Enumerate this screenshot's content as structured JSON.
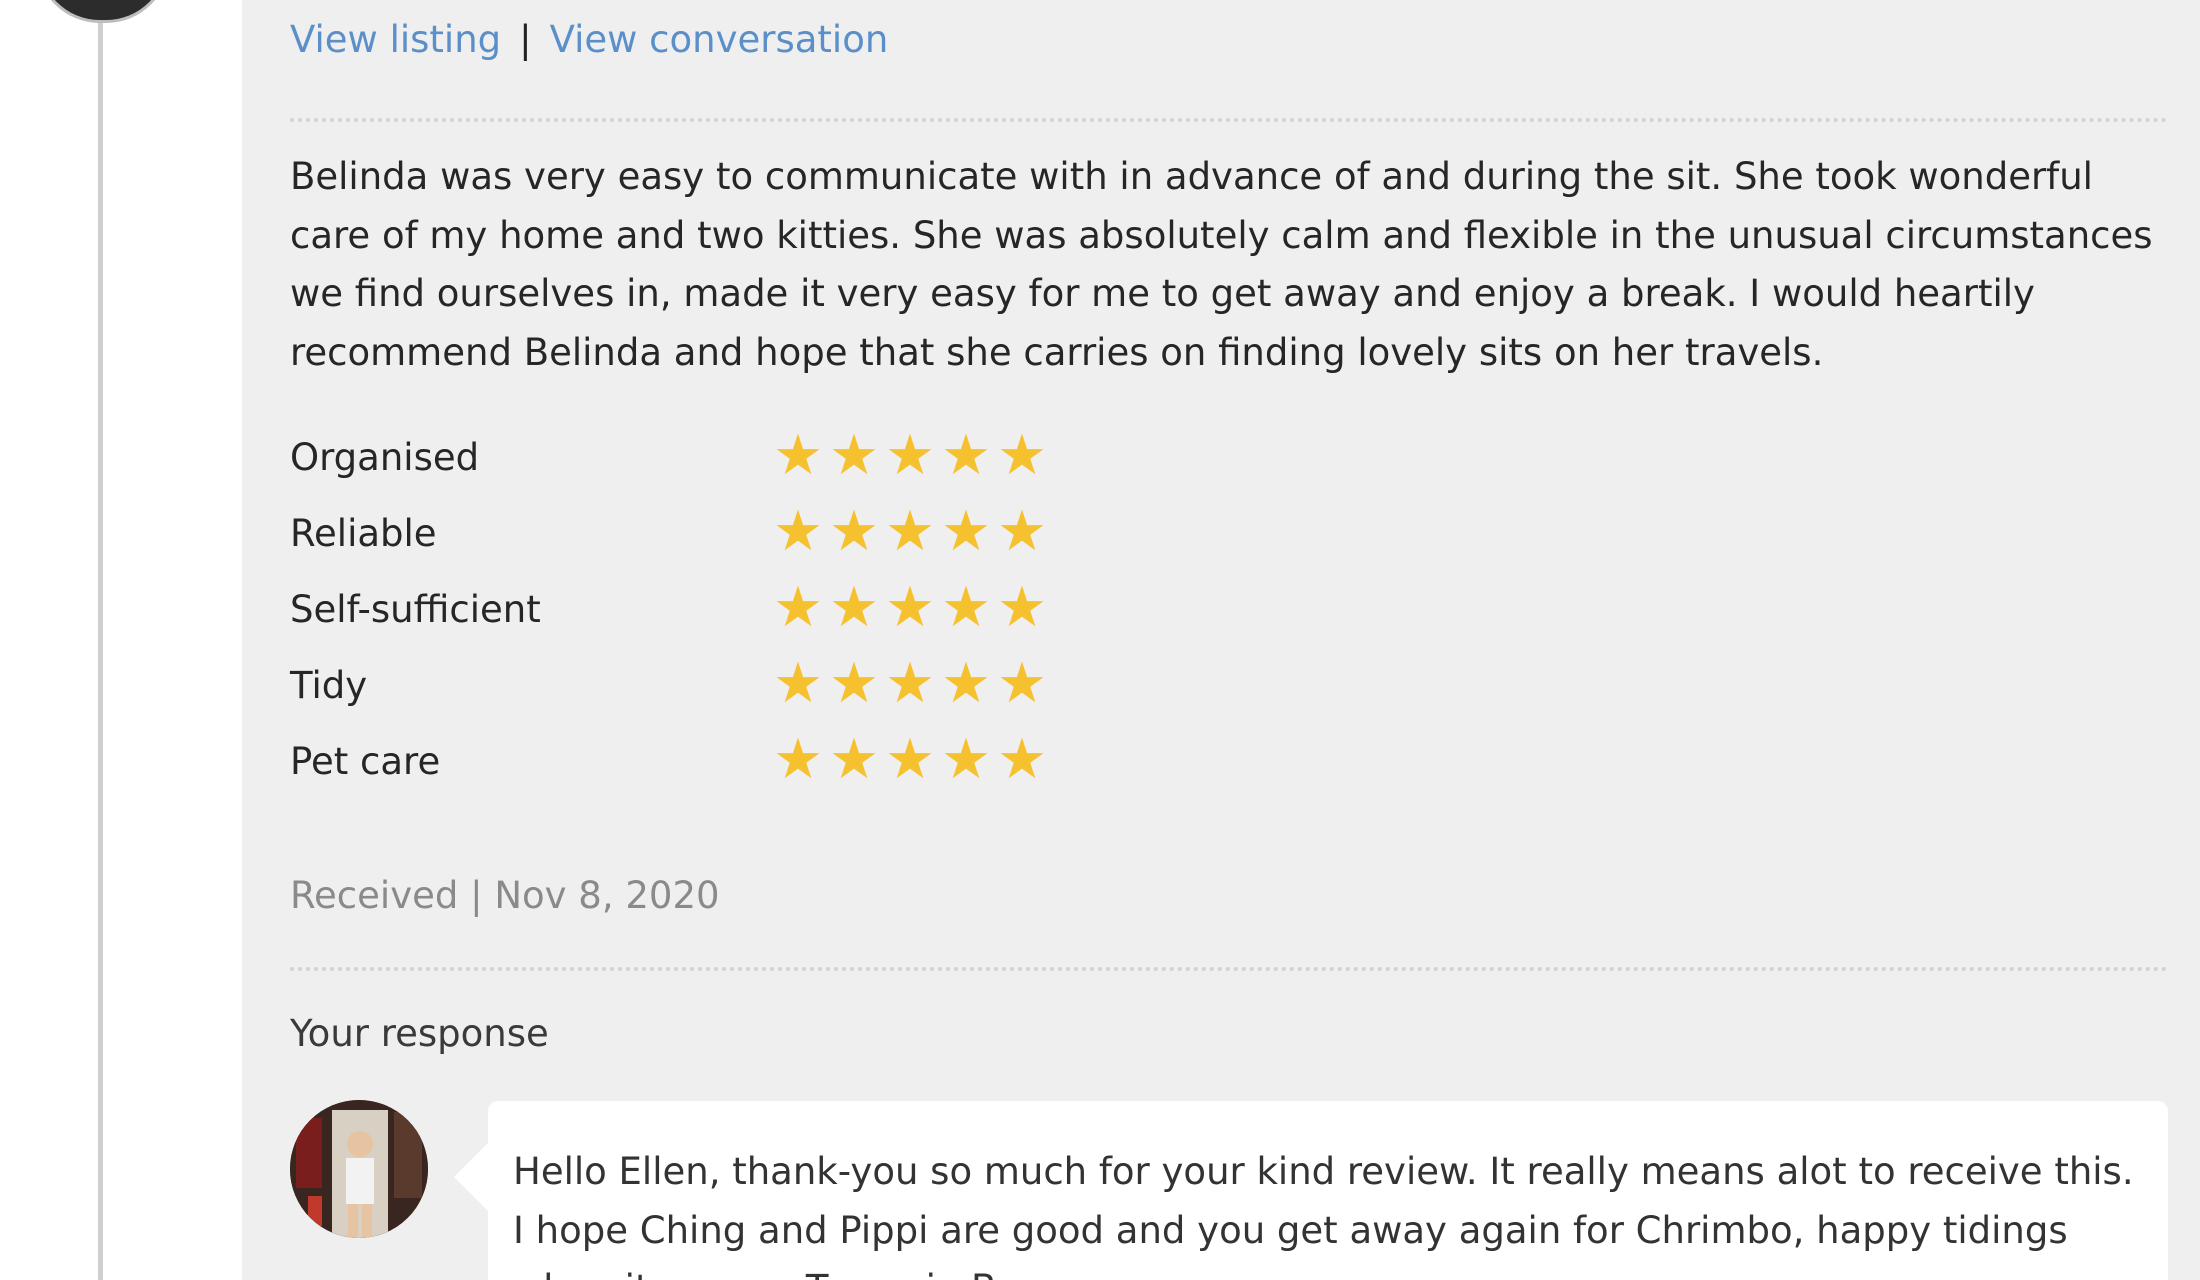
{
  "review": {
    "links": {
      "view_listing": "View listing",
      "separator": "|",
      "view_conversation": "View conversation"
    },
    "text": "Belinda was very easy to communicate with in advance of and during the sit. She took wonderful care of my home and two kitties. She was absolutely calm and flexible in the unusual circumstances we find ourselves in, made it very easy for me to get away and enjoy a break. I would heartily recommend Belinda and hope that she carries on finding lovely sits on her travels.",
    "ratings": [
      {
        "label": "Organised",
        "stars": 5,
        "max": 5
      },
      {
        "label": "Reliable",
        "stars": 5,
        "max": 5
      },
      {
        "label": "Self-sufficient",
        "stars": 5,
        "max": 5
      },
      {
        "label": "Tidy",
        "stars": 5,
        "max": 5
      },
      {
        "label": "Pet care",
        "stars": 5,
        "max": 5
      }
    ],
    "received": "Received | Nov 8, 2020"
  },
  "response": {
    "heading": "Your response",
    "text": "Hello Ellen, thank-you so much for your kind review. It really means alot to receive this. I hope Ching and Pippi are good and you get away again for Chrimbo, happy tidings when it comes. Ta again B x"
  },
  "colors": {
    "card_background": "#efefef",
    "link": "#5b8fc9",
    "star_filled": "#f6c12e",
    "muted_text": "#8a8a8a"
  },
  "icons": {
    "rating_star": "star-icon"
  }
}
